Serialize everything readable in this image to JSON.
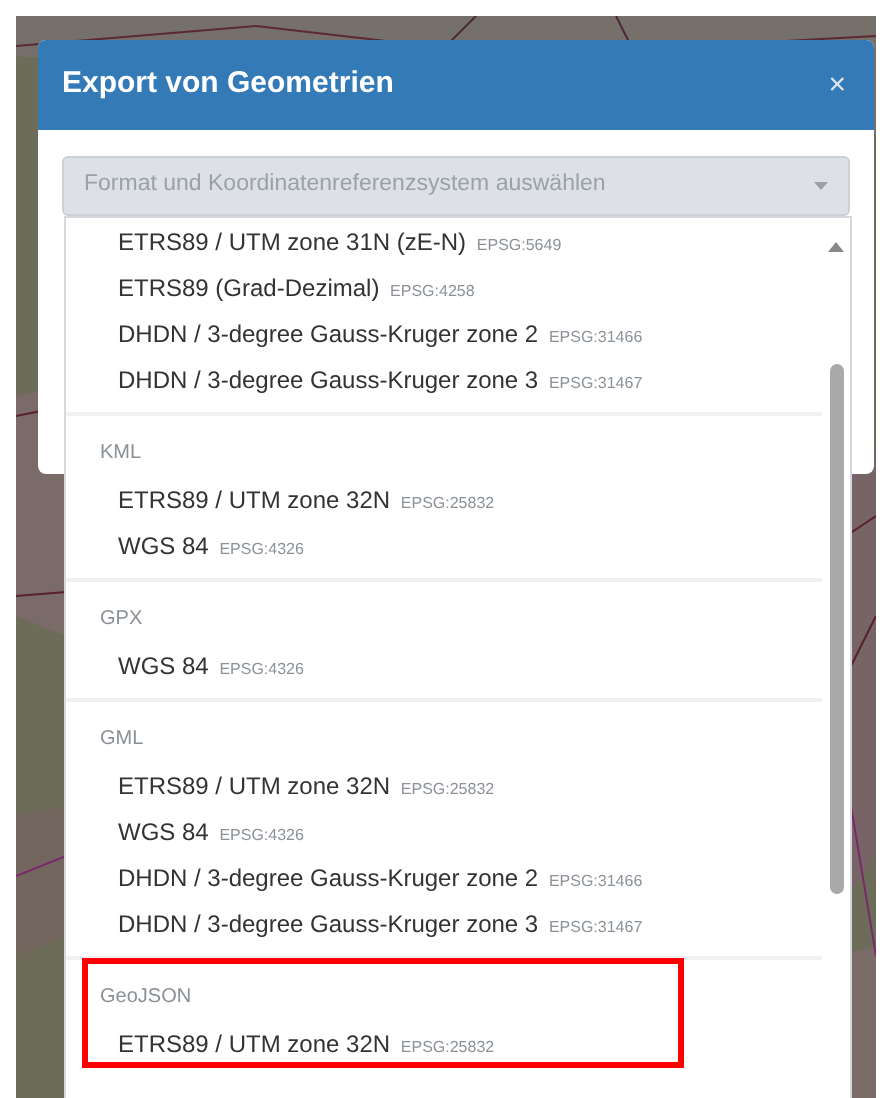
{
  "dialog": {
    "title": "Export von Geometrien",
    "close": "×",
    "select": {
      "placeholder": "Format und Koordinatenreferenzsystem auswählen"
    }
  },
  "dropdown": {
    "groups": [
      {
        "highlighted": false,
        "items": [
          {
            "name": "ETRS89 / UTM zone 31N (zE-N)",
            "code": "EPSG:5649"
          },
          {
            "name": "ETRS89 (Grad-Dezimal)",
            "code": "EPSG:4258"
          },
          {
            "name": "DHDN / 3-degree Gauss-Kruger zone 2",
            "code": "EPSG:31466"
          },
          {
            "name": "DHDN / 3-degree Gauss-Kruger zone 3",
            "code": "EPSG:31467"
          }
        ]
      },
      {
        "label": "KML",
        "highlighted": false,
        "items": [
          {
            "name": "ETRS89 / UTM zone 32N",
            "code": "EPSG:25832"
          },
          {
            "name": "WGS 84",
            "code": "EPSG:4326"
          }
        ]
      },
      {
        "label": "GPX",
        "highlighted": false,
        "items": [
          {
            "name": "WGS 84",
            "code": "EPSG:4326"
          }
        ]
      },
      {
        "label": "GML",
        "highlighted": false,
        "items": [
          {
            "name": "ETRS89 / UTM zone 32N",
            "code": "EPSG:25832"
          },
          {
            "name": "WGS 84",
            "code": "EPSG:4326"
          },
          {
            "name": "DHDN / 3-degree Gauss-Kruger zone 2",
            "code": "EPSG:31466"
          },
          {
            "name": "DHDN / 3-degree Gauss-Kruger zone 3",
            "code": "EPSG:31467"
          }
        ]
      },
      {
        "label": "GeoJSON",
        "highlighted": true,
        "items": [
          {
            "name": "ETRS89 / UTM zone 32N",
            "code": "EPSG:25832"
          }
        ]
      }
    ]
  }
}
